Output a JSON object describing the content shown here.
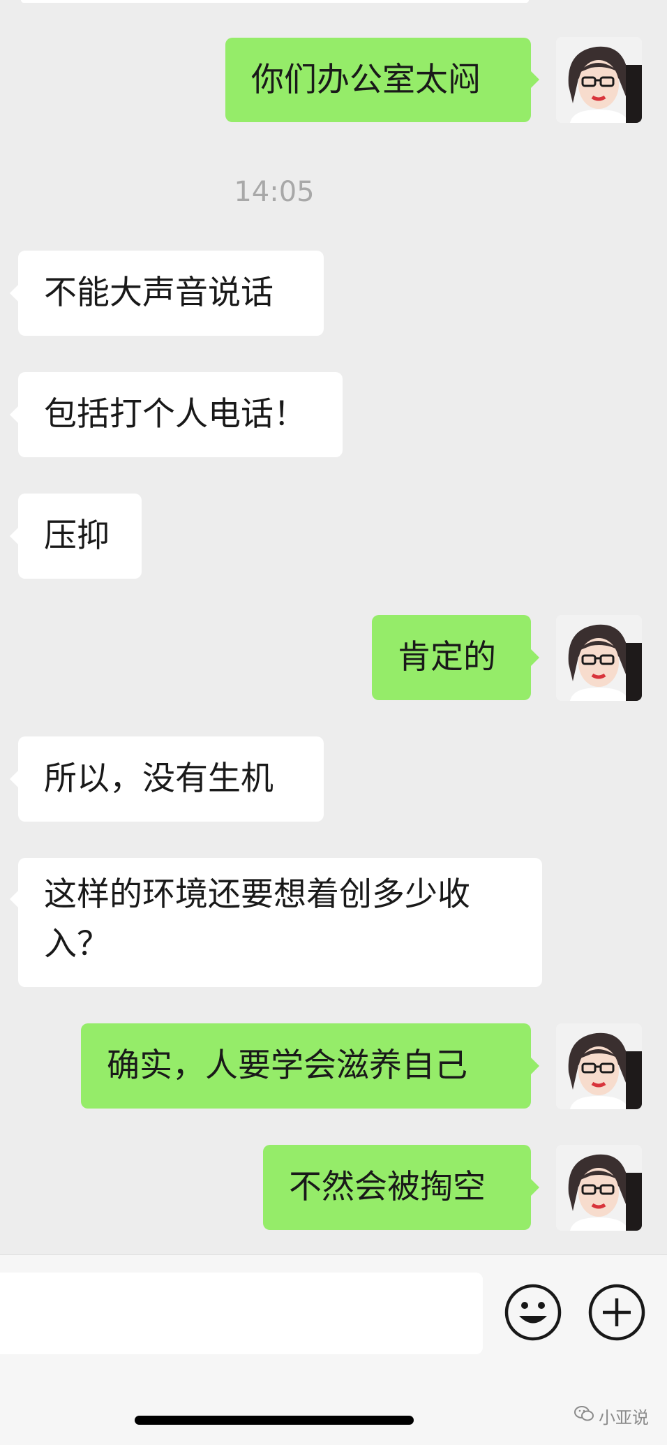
{
  "messages": [
    {
      "side": "out",
      "text": "你们办公室太闷"
    },
    {
      "side": "in",
      "text": "不能大声音说话"
    },
    {
      "side": "in",
      "text": "包括打个人电话！"
    },
    {
      "side": "in",
      "text": "压抑"
    },
    {
      "side": "out",
      "text": "肯定的"
    },
    {
      "side": "in",
      "text": "所以，没有生机"
    },
    {
      "side": "in",
      "text": "这样的环境还要想着创多少收入？"
    },
    {
      "side": "out",
      "text": "确实，人要学会滋养自己"
    },
    {
      "side": "out",
      "text": "不然会被掏空"
    }
  ],
  "timestamp": "14:05",
  "input": {
    "placeholder": ""
  },
  "icons": {
    "emoji": "emoji-smile-icon",
    "more": "plus-circle-icon",
    "watermark": "wechat-official-account-icon"
  },
  "watermark_text": "小亚说",
  "colors": {
    "background": "#ededed",
    "outgoing_bubble": "#95ec69",
    "incoming_bubble": "#ffffff",
    "timestamp": "#a8a8a8"
  }
}
